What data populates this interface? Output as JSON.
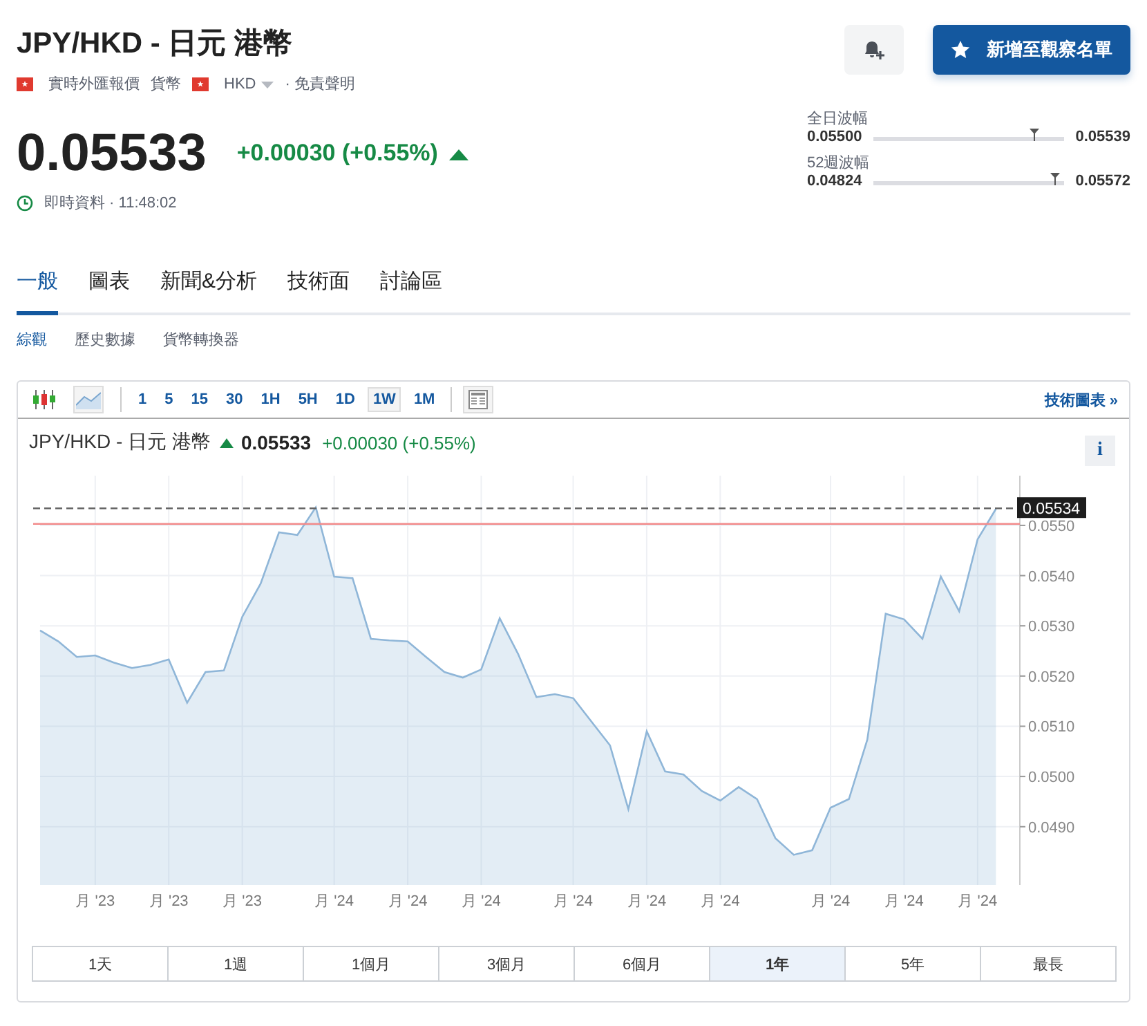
{
  "header": {
    "title": "JPY/HKD - 日元 港幣",
    "meta": [
      {
        "kind": "flag",
        "text": "實時外匯報價"
      },
      {
        "kind": "plain",
        "text": "貨幣"
      },
      {
        "kind": "flag-dropdown",
        "text": "HKD"
      },
      {
        "kind": "plain",
        "text": "· 免責聲明"
      }
    ],
    "price": "0.05533",
    "change": "+0.00030 (+0.55%)",
    "rising": true,
    "status": "即時資料 · 11:48:02",
    "watchlist_button": "新增至觀察名單",
    "ranges": [
      {
        "label": "全日波幅",
        "low": "0.05500",
        "high": "0.05539",
        "level": 0.84
      },
      {
        "label": "52週波幅",
        "low": "0.04824",
        "high": "0.05572",
        "level": 0.95
      }
    ]
  },
  "tabs": [
    {
      "label": "一般",
      "selected": true
    },
    {
      "label": "圖表",
      "selected": false
    },
    {
      "label": "新聞&分析",
      "selected": false
    },
    {
      "label": "技術面",
      "selected": false
    },
    {
      "label": "討論區",
      "selected": false
    }
  ],
  "subtabs": [
    {
      "label": "綜觀",
      "selected": true
    },
    {
      "label": "歷史數據",
      "selected": false
    },
    {
      "label": "貨幣轉換器",
      "selected": false
    }
  ],
  "chart_panel": {
    "chart_types": [
      {
        "kind": "candles",
        "selected": false
      },
      {
        "kind": "area",
        "selected": true
      }
    ],
    "intervals": [
      {
        "label": "1",
        "selected": false
      },
      {
        "label": "5",
        "selected": false
      },
      {
        "label": "15",
        "selected": false
      },
      {
        "label": "30",
        "selected": false
      },
      {
        "label": "1H",
        "selected": false
      },
      {
        "label": "5H",
        "selected": false
      },
      {
        "label": "1D",
        "selected": false
      },
      {
        "label": "1W",
        "selected": true
      },
      {
        "label": "1M",
        "selected": false
      }
    ],
    "technical_link": "技術圖表 »",
    "symbol": "JPY/HKD - 日元 港幣",
    "price": "0.05533",
    "change": "+0.00030 (+0.55%)",
    "rising": true,
    "info_button": "i",
    "chart_data": {
      "type": "area",
      "categories": [
        null,
        null,
        null,
        "月 '23",
        null,
        null,
        null,
        "月 '23",
        null,
        null,
        null,
        "月 '23",
        null,
        null,
        null,
        null,
        "月 '24",
        null,
        null,
        null,
        "月 '24",
        null,
        null,
        null,
        "月 '24",
        null,
        null,
        null,
        null,
        "月 '24",
        null,
        null,
        null,
        "月 '24",
        null,
        null,
        null,
        "月 '24",
        null,
        null,
        null,
        null,
        null,
        "月 '24",
        null,
        null,
        null,
        "月 '24",
        null,
        null,
        null,
        "月 '24",
        null
      ],
      "series": [
        {
          "color": "#8fb6d8",
          "values": [
            0.05291,
            0.05269,
            0.05238,
            0.05241,
            0.05227,
            0.05216,
            0.05222,
            0.05233,
            0.05147,
            0.05208,
            0.05211,
            0.05318,
            0.05384,
            0.05486,
            0.05481,
            0.05536,
            0.05398,
            0.05395,
            0.05274,
            0.05271,
            0.05269,
            0.05238,
            0.05208,
            0.05197,
            0.05213,
            0.05315,
            0.05244,
            0.05158,
            0.05164,
            0.05156,
            0.05109,
            0.05062,
            0.04935,
            0.0509,
            0.0501,
            0.05004,
            0.04971,
            0.04952,
            0.04979,
            0.04955,
            0.04877,
            0.04844,
            0.04853,
            0.04938,
            0.04955,
            0.05073,
            0.05324,
            0.05313,
            0.05274,
            0.05398,
            0.05329,
            0.05472,
            0.05533
          ]
        }
      ],
      "ylim": [
        0.04784,
        0.05599
      ],
      "yticks": [
        {
          "value": 0.049,
          "label": "0.0490"
        },
        {
          "value": 0.05,
          "label": "0.0500"
        },
        {
          "value": 0.051,
          "label": "0.0510"
        },
        {
          "value": 0.052,
          "label": "0.0520"
        },
        {
          "value": 0.053,
          "label": "0.0530"
        },
        {
          "value": 0.054,
          "label": "0.0540"
        },
        {
          "value": 0.055,
          "label": "0.0550"
        }
      ],
      "grid": true,
      "ref_lines": [
        {
          "axis": "y",
          "value": 0.05534,
          "label": "0.05534",
          "color": "#666666"
        },
        {
          "axis": "y",
          "value": 0.05503,
          "color": "#f28b8b"
        }
      ]
    },
    "periods": [
      {
        "label": "1天",
        "selected": false
      },
      {
        "label": "1週",
        "selected": false
      },
      {
        "label": "1個月",
        "selected": false
      },
      {
        "label": "3個月",
        "selected": false
      },
      {
        "label": "6個月",
        "selected": false
      },
      {
        "label": "1年",
        "selected": true
      },
      {
        "label": "5年",
        "selected": false
      },
      {
        "label": "最長",
        "selected": false
      }
    ]
  }
}
